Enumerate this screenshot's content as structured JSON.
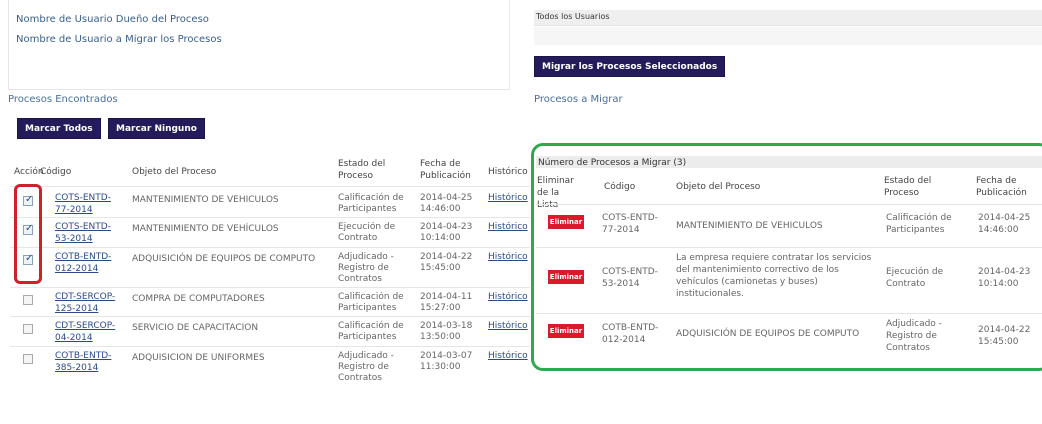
{
  "user_fields": {
    "owner_label": "Nombre de Usuario Dueño del Proceso",
    "migrate_label": "Nombre de Usuario a Migrar los Procesos",
    "all_users_label": "Todos los Usuarios"
  },
  "migrate_selected_button": "Migrar los Procesos Seleccionados",
  "found": {
    "title": "Procesos Encontrados",
    "select_all_button": "Marcar Todos",
    "select_none_button": "Marcar Ninguno",
    "columns": [
      "Acción",
      "Código",
      "Objeto del Proceso",
      "Estado del Proceso",
      "Fecha de Publicación",
      "Histórico"
    ],
    "rows": [
      {
        "checked": true,
        "code_1": "COTS-ENTD-",
        "code_2": "77-2014",
        "object": "MANTENIMIENTO DE VEHICULOS",
        "state_1": "Calificación de",
        "state_2": "Participantes",
        "state_3": "",
        "date_1": "2014-04-25",
        "date_2": "14:46:00",
        "history": "Histórico"
      },
      {
        "checked": true,
        "code_1": "COTS-ENTD-",
        "code_2": "53-2014",
        "object": "MANTENIMIENTO DE VEHÍCULOS",
        "state_1": "Ejecución de",
        "state_2": "Contrato",
        "state_3": "",
        "date_1": "2014-04-23",
        "date_2": "10:14:00",
        "history": "Histórico"
      },
      {
        "checked": true,
        "code_1": "COTB-ENTD-",
        "code_2": "012-2014",
        "object": "ADQUISICIÓN DE EQUIPOS DE COMPUTO",
        "state_1": "Adjudicado -",
        "state_2": "Registro de",
        "state_3": "Contratos",
        "date_1": "2014-04-22",
        "date_2": "15:45:00",
        "history": "Histórico"
      },
      {
        "checked": false,
        "code_1": "CDT-SERCOP-",
        "code_2": "125-2014",
        "object": "COMPRA DE COMPUTADORES",
        "state_1": "Calificación de",
        "state_2": "Participantes",
        "state_3": "",
        "date_1": "2014-04-11",
        "date_2": "15:27:00",
        "history": "Histórico"
      },
      {
        "checked": false,
        "code_1": "CDT-SERCOP-",
        "code_2": "04-2014",
        "object": "SERVICIO DE CAPACITACION",
        "state_1": "Calificación de",
        "state_2": "Participantes",
        "state_3": "",
        "date_1": "2014-03-18",
        "date_2": "13:50:00",
        "history": "Histórico"
      },
      {
        "checked": false,
        "code_1": "COTB-ENTD-",
        "code_2": "385-2014",
        "object": "ADQUISICION DE UNIFORMES",
        "state_1": "Adjudicado -",
        "state_2": "Registro de",
        "state_3": "Contratos",
        "date_1": "2014-03-07",
        "date_2": "11:30:00",
        "history": "Histórico"
      }
    ]
  },
  "to_migrate": {
    "title": "Procesos a Migrar",
    "panel_title": "Número de Procesos a Migrar (3)",
    "columns": [
      "Eliminar de la Lista",
      "Código",
      "Objeto del Proceso",
      "Estado del Proceso",
      "Fecha de Publicación"
    ],
    "remove_label": "Eliminar",
    "rows": [
      {
        "code_1": "COTS-ENTD-",
        "code_2": "77-2014",
        "object_1": "MANTENIMIENTO DE VEHICULOS",
        "object_2": "",
        "object_3": "",
        "object_4": "",
        "state_1": "Calificación de",
        "state_2": "Participantes",
        "state_3": "",
        "date_1": "2014-04-25",
        "date_2": "14:46:00"
      },
      {
        "code_1": "COTS-ENTD-",
        "code_2": "53-2014",
        "object_1": "La empresa requiere contratar los servicios",
        "object_2": "del mantenimiento correctivo de los",
        "object_3": "vehículos (camionetas y buses)",
        "object_4": "institucionales.",
        "state_1": "Ejecución de",
        "state_2": "Contrato",
        "state_3": "",
        "date_1": "2014-04-23",
        "date_2": "10:14:00"
      },
      {
        "code_1": "COTB-ENTD-",
        "code_2": "012-2014",
        "object_1": "ADQUISICIÓN DE EQUIPOS DE COMPUTO",
        "object_2": "",
        "object_3": "",
        "object_4": "",
        "state_1": "Adjudicado -",
        "state_2": "Registro de",
        "state_3": "Contratos",
        "date_1": "2014-04-22",
        "date_2": "15:45:00"
      }
    ]
  },
  "colors": {
    "highlight_red": "#d0202c",
    "highlight_green": "#2fa84f",
    "navy": "#241c5a"
  }
}
